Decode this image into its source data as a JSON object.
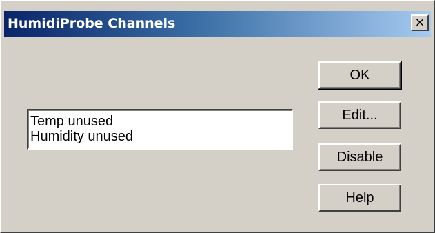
{
  "window": {
    "title": "HumidiProbe Channels",
    "close_glyph": "×"
  },
  "channels": {
    "items": [
      "Temp unused",
      "Humidity unused"
    ]
  },
  "buttons": {
    "ok": "OK",
    "edit": "Edit...",
    "disable": "Disable",
    "help": "Help"
  },
  "colors": {
    "dialog_face": "#d4d0c8",
    "title_gradient_start": "#0a246a",
    "title_gradient_end": "#a6caf0",
    "title_text": "#ffffff"
  },
  "icons": {
    "close": "close-icon"
  }
}
